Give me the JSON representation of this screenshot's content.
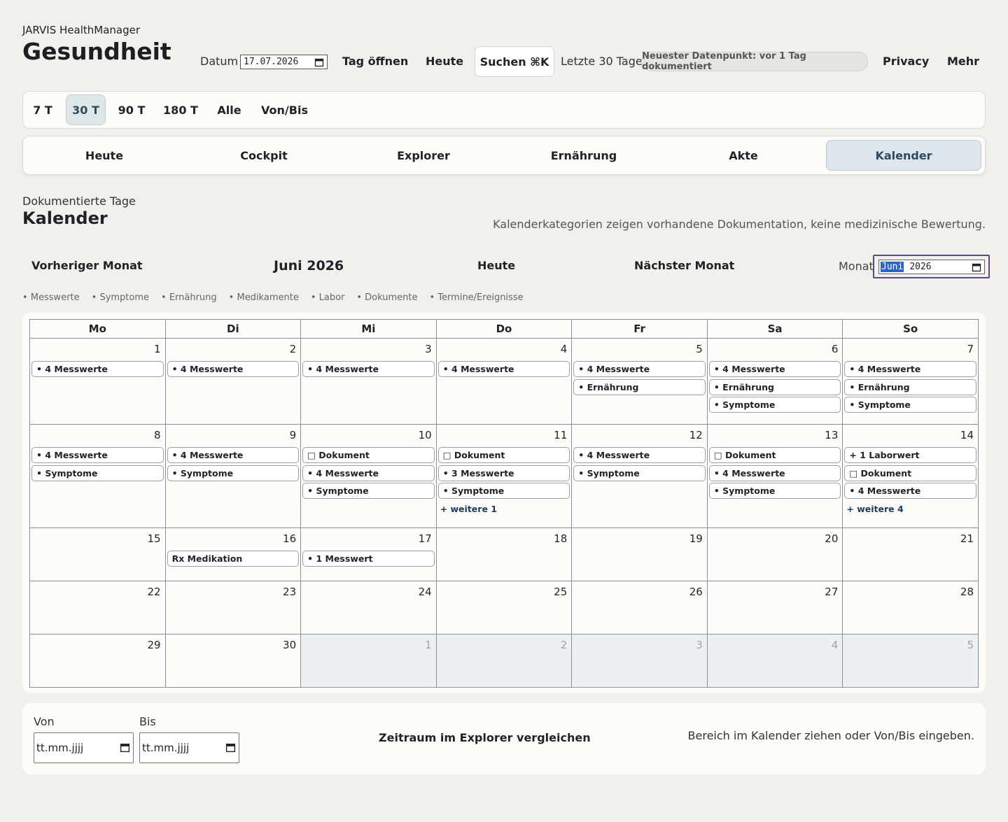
{
  "header": {
    "app_name": "JARVIS HealthManager",
    "title": "Gesundheit",
    "datum_label": "Datum",
    "datum_value": "17.07.2026",
    "open_day": "Tag öffnen",
    "today": "Heute",
    "search": "Suchen ⌘K",
    "range": "Letzte 30 Tage",
    "badge": "Neuester Datenpunkt: vor 1 Tag dokumentiert",
    "privacy": "Privacy",
    "more": "Mehr"
  },
  "periods": [
    "7 T",
    "30 T",
    "90 T",
    "180 T",
    "Alle",
    "Von/Bis"
  ],
  "active_period": "30 T",
  "tabs": [
    "Heute",
    "Cockpit",
    "Explorer",
    "Ernährung",
    "Akte",
    "Kalender"
  ],
  "active_tab": "Kalender",
  "section": {
    "subtitle": "Dokumentierte Tage",
    "title": "Kalender",
    "note": "Kalenderkategorien zeigen vorhandene Dokumentation, keine medizinische Bewertung."
  },
  "month_nav": {
    "prev": "Vorheriger Monat",
    "current": "Juni 2026",
    "today": "Heute",
    "next": "Nächster Monat",
    "month_label": "Monat",
    "month_input_selected": "Juni",
    "month_input_year": "2026"
  },
  "legend": [
    "• Messwerte",
    "• Symptome",
    "• Ernährung",
    "• Medikamente",
    "• Labor",
    "• Dokumente",
    "• Termine/Ereignisse"
  ],
  "weekdays": [
    "Mo",
    "Di",
    "Mi",
    "Do",
    "Fr",
    "Sa",
    "So"
  ],
  "weeks": [
    [
      {
        "day": "1",
        "items": [
          "• 4 Messwerte"
        ]
      },
      {
        "day": "2",
        "items": [
          "• 4 Messwerte"
        ]
      },
      {
        "day": "3",
        "items": [
          "• 4 Messwerte"
        ]
      },
      {
        "day": "4",
        "items": [
          "• 4 Messwerte"
        ]
      },
      {
        "day": "5",
        "items": [
          "• 4 Messwerte",
          "• Ernährung"
        ]
      },
      {
        "day": "6",
        "items": [
          "• 4 Messwerte",
          "• Ernährung",
          "• Symptome"
        ]
      },
      {
        "day": "7",
        "items": [
          "• 4 Messwerte",
          "• Ernährung",
          "• Symptome"
        ]
      }
    ],
    [
      {
        "day": "8",
        "items": [
          "• 4 Messwerte",
          "• Symptome"
        ]
      },
      {
        "day": "9",
        "items": [
          "• 4 Messwerte",
          "• Symptome"
        ]
      },
      {
        "day": "10",
        "items": [
          "□ Dokument",
          "• 4 Messwerte",
          "• Symptome"
        ]
      },
      {
        "day": "11",
        "items": [
          "□ Dokument",
          "• 3 Messwerte",
          "• Symptome"
        ],
        "more": "+ weitere 1"
      },
      {
        "day": "12",
        "items": [
          "• 4 Messwerte",
          "• Symptome"
        ]
      },
      {
        "day": "13",
        "items": [
          "□ Dokument",
          "• 4 Messwerte",
          "• Symptome"
        ]
      },
      {
        "day": "14",
        "items": [
          "+ 1 Laborwert",
          "□ Dokument",
          "• 4 Messwerte"
        ],
        "more": "+ weitere 4"
      }
    ],
    [
      {
        "day": "15",
        "items": []
      },
      {
        "day": "16",
        "items": [
          "Rx Medikation"
        ]
      },
      {
        "day": "17",
        "items": [
          "• 1 Messwert"
        ]
      },
      {
        "day": "18",
        "items": []
      },
      {
        "day": "19",
        "items": []
      },
      {
        "day": "20",
        "items": []
      },
      {
        "day": "21",
        "items": []
      }
    ],
    [
      {
        "day": "22",
        "items": []
      },
      {
        "day": "23",
        "items": []
      },
      {
        "day": "24",
        "items": []
      },
      {
        "day": "25",
        "items": []
      },
      {
        "day": "26",
        "items": []
      },
      {
        "day": "27",
        "items": []
      },
      {
        "day": "28",
        "items": []
      }
    ],
    [
      {
        "day": "29",
        "items": []
      },
      {
        "day": "30",
        "items": []
      },
      {
        "day": "1",
        "items": [],
        "other": true
      },
      {
        "day": "2",
        "items": [],
        "other": true
      },
      {
        "day": "3",
        "items": [],
        "other": true
      },
      {
        "day": "4",
        "items": [],
        "other": true
      },
      {
        "day": "5",
        "items": [],
        "other": true
      }
    ]
  ],
  "bottom": {
    "from_label": "Von",
    "to_label": "Bis",
    "from_placeholder": "tt.mm.jjjj",
    "to_placeholder": "tt.mm.jjjj",
    "compare": "Zeitraum im Explorer vergleichen",
    "hint": "Bereich im Kalender ziehen oder Von/Bis eingeben."
  },
  "colors": {
    "background": "#f1f0ec",
    "card": "#fdfcf8",
    "active": "#dce6ec",
    "active_text": "#2e4a5f",
    "focus_ring": "#5a4a7d",
    "other_month": "#eceff3"
  }
}
